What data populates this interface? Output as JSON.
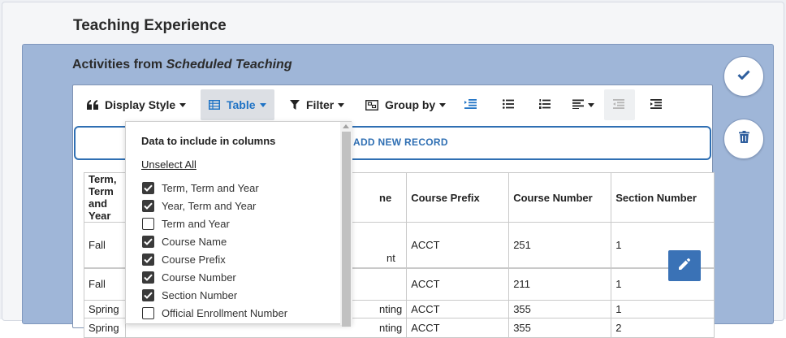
{
  "page": {
    "title": "Teaching Experience"
  },
  "section": {
    "title_prefix": "Activities from ",
    "title_source": "Scheduled Teaching"
  },
  "toolbar": {
    "display_style": "Display Style",
    "table": "Table",
    "filter": "Filter",
    "group_by": "Group by"
  },
  "add_record": {
    "label": "ADD NEW RECORD"
  },
  "dropdown": {
    "heading": "Data to include in columns",
    "unselect_all": "Unselect All",
    "items": [
      {
        "label": "Term, Term and Year",
        "checked": true
      },
      {
        "label": "Year, Term and Year",
        "checked": true
      },
      {
        "label": "Term and Year",
        "checked": false
      },
      {
        "label": "Course Name",
        "checked": true
      },
      {
        "label": "Course Prefix",
        "checked": true
      },
      {
        "label": "Course Number",
        "checked": true
      },
      {
        "label": "Section Number",
        "checked": true
      },
      {
        "label": "Official Enrollment Number",
        "checked": false
      }
    ]
  },
  "table": {
    "headers": {
      "term": "Term, Term and Year",
      "course_name_partial": "ne",
      "course_prefix": "Course Prefix",
      "course_number": "Course Number",
      "section_number": "Section Number"
    },
    "rows": [
      {
        "term": "Fall",
        "name_partial": "nt",
        "prefix": "ACCT",
        "number": "251",
        "section": "1"
      },
      {
        "term": "Fall",
        "name_partial": "",
        "prefix": "ACCT",
        "number": "211",
        "section": "1"
      },
      {
        "term": "Spring",
        "name_partial": "nting",
        "prefix": "ACCT",
        "number": "355",
        "section": "1"
      },
      {
        "term": "Spring",
        "name_partial": "nting",
        "prefix": "ACCT",
        "number": "355",
        "section": "2"
      }
    ]
  },
  "colors": {
    "accent": "#2f6fb3",
    "panel": "#9fb6d8",
    "edit": "#3a72b6"
  }
}
